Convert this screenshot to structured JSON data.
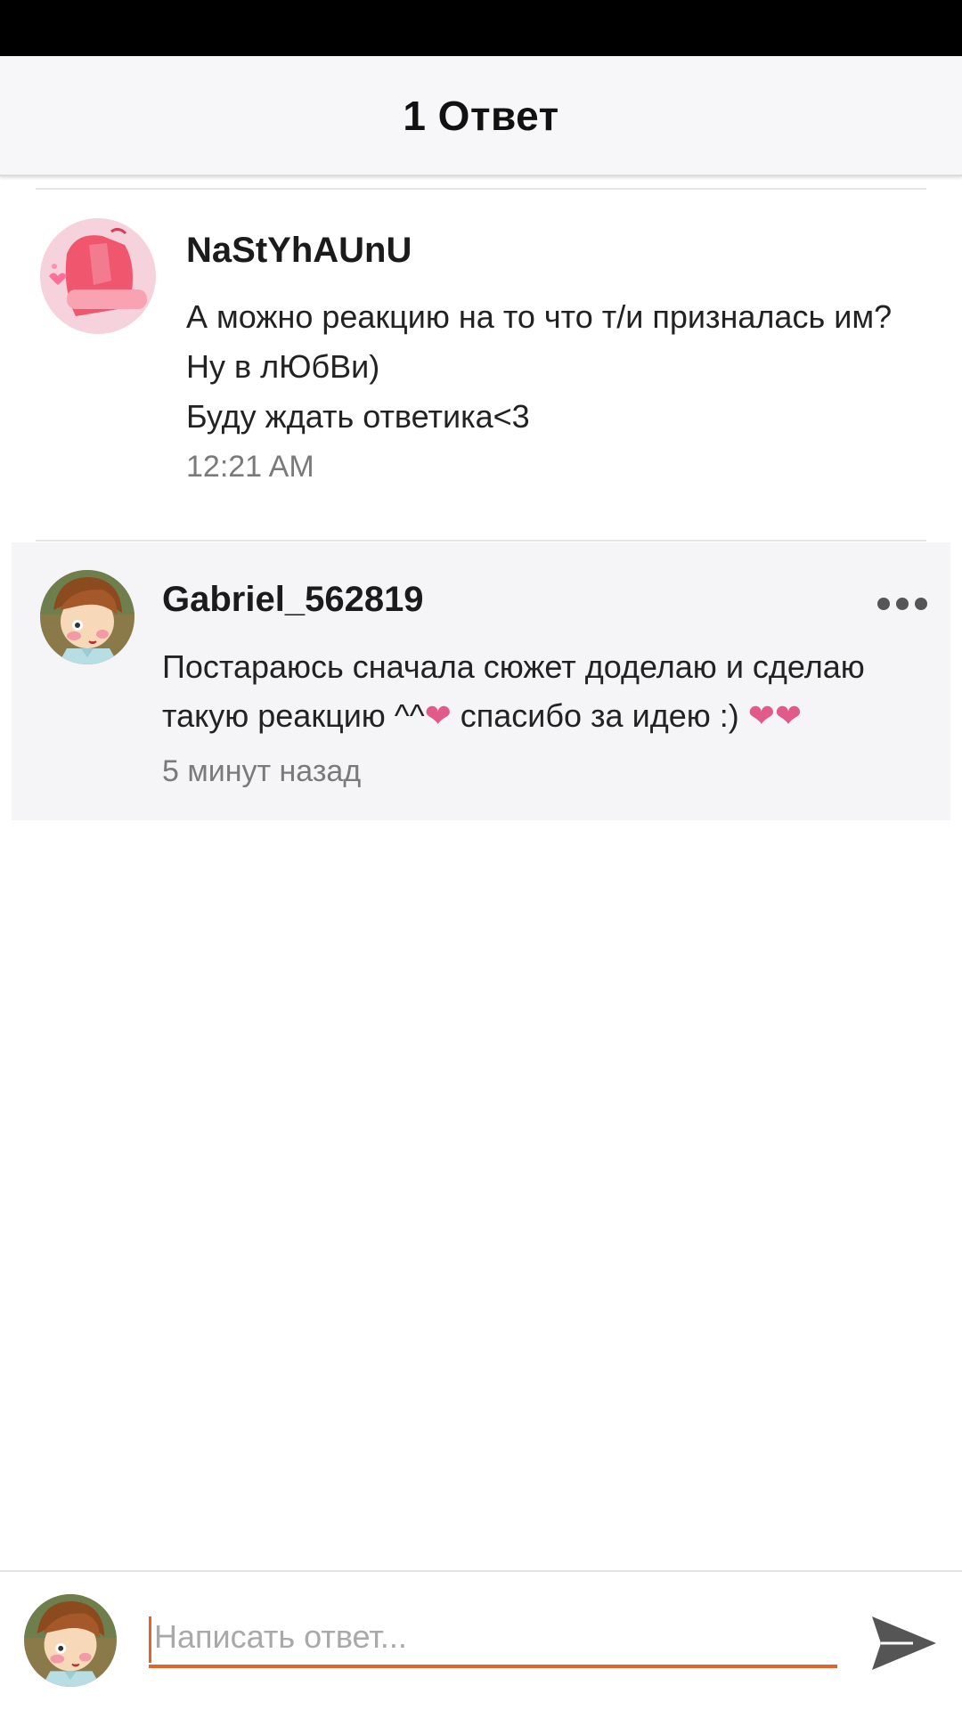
{
  "header": {
    "title": "1 Ответ"
  },
  "original_comment": {
    "author": "NaStYhAUnU",
    "lines": [
      "А можно реакцию на то что т/и призналась им?",
      "Ну в лЮбВи)",
      "Буду ждать ответика<3"
    ],
    "time": "12:21 AM"
  },
  "reply": {
    "author": "Gabriel_562819",
    "line1": "Постараюсь сначала сюжет доделаю и сделаю",
    "line2_a": "такую реакцию ^^",
    "line2_b": "спасибо за идею :)",
    "heart": "❤",
    "time": "5 минут назад",
    "more_icon": "more-horizontal-icon"
  },
  "composer": {
    "placeholder": "Написать ответ...",
    "send_icon": "send-icon",
    "accent": "#e2642a"
  }
}
